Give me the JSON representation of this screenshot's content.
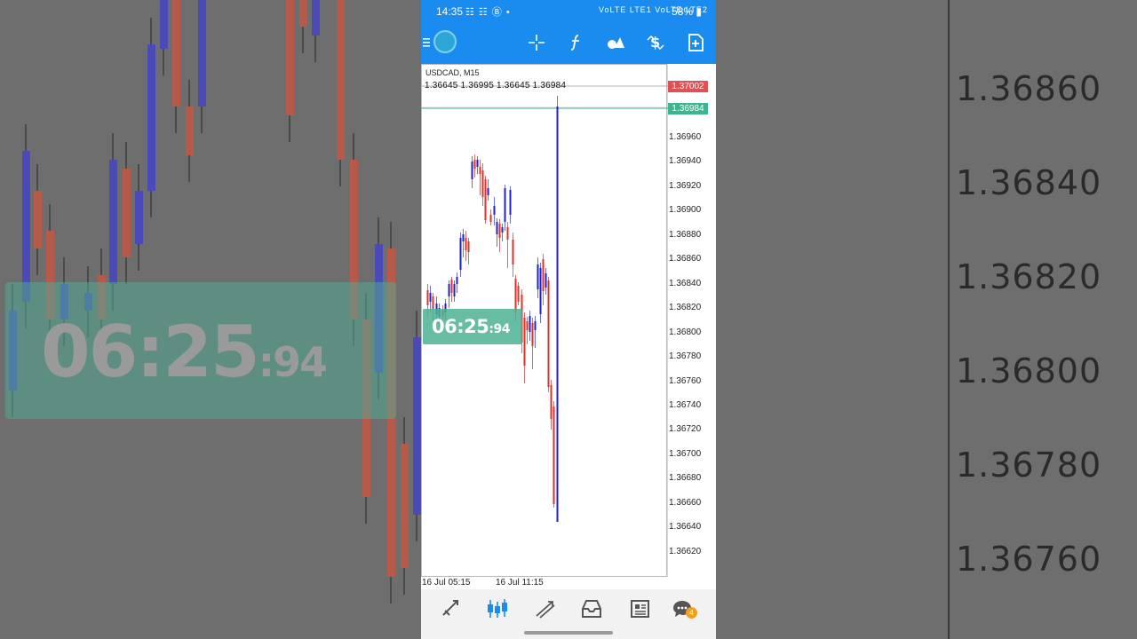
{
  "status_bar": {
    "time": "14:35",
    "left_icons": "☷ ☷ Ⓑ •",
    "signal": "VoLTE LTE1 VoLTE LTE2",
    "battery": "58%"
  },
  "toolbar": {
    "icons": [
      "menu-icon",
      "app-logo",
      "crosshair-icon",
      "function-icon",
      "objects-icon",
      "trade-dollar-icon",
      "new-order-icon"
    ]
  },
  "chart": {
    "symbol": "USDCAD, M15",
    "ohlc": "1.36645 1.36995 1.36645 1.36984",
    "ask_price": "1.37002",
    "bid_price": "1.36984",
    "timer_main": "06:25",
    "timer_sub": ":94",
    "y_ticks": [
      "1.36960",
      "1.36940",
      "1.36920",
      "1.36900",
      "1.36880",
      "1.36860",
      "1.36840",
      "1.36820",
      "1.36800",
      "1.36780",
      "1.36760",
      "1.36740",
      "1.36720",
      "1.36700",
      "1.36680",
      "1.36660",
      "1.36640",
      "1.36620"
    ],
    "x_ticks": [
      "16 Jul 05:15",
      "16 Jul 11:15"
    ],
    "colors": {
      "bull": "#2020c8",
      "bear": "#e0302a",
      "ask_line": "#b0b0b0",
      "bid_line": "#3db591"
    }
  },
  "background": {
    "price_labels": [
      "1.36860",
      "1.36840",
      "1.36820",
      "1.36800",
      "1.36780",
      "1.36760"
    ],
    "timer_main": "06:25",
    "timer_sub": ":94"
  },
  "bottom_nav": {
    "icons": [
      "quotes-icon",
      "chart-icon",
      "trade-icon",
      "history-icon",
      "news-icon",
      "chat-icon"
    ],
    "chat_badge": "4"
  }
}
